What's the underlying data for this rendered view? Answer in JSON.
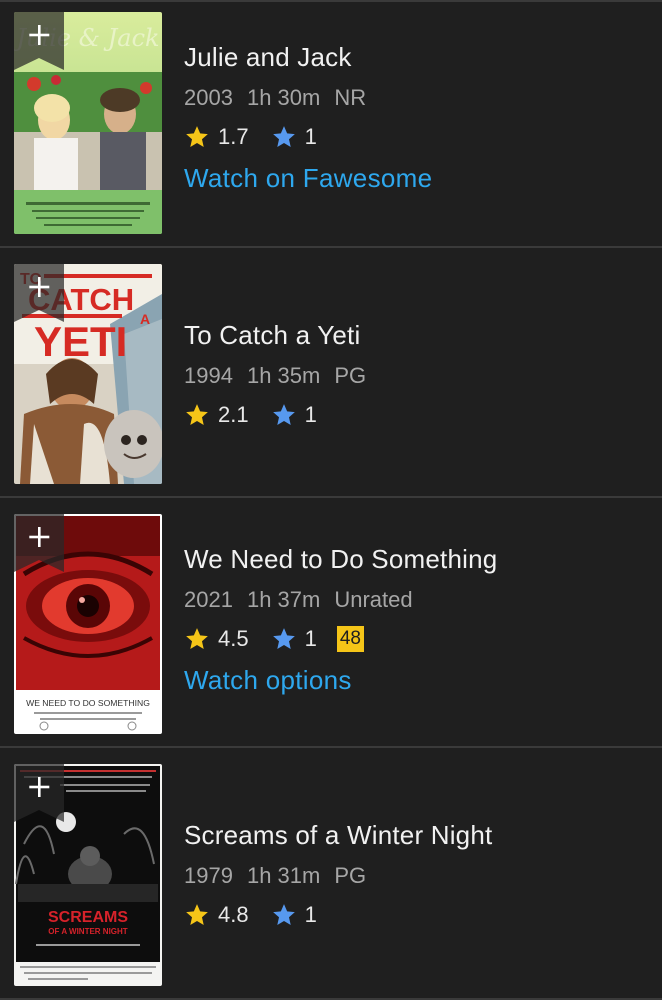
{
  "colors": {
    "imdb_star": "#f5c518",
    "user_star": "#5799ef",
    "link": "#2ea8ee",
    "metascore_bg": "#f5c518"
  },
  "items": [
    {
      "title": "Julie and Jack",
      "year": "2003",
      "runtime": "1h 30m",
      "certificate": "NR",
      "rating": "1.7",
      "user_rating": "1",
      "link": "Watch on Fawesome",
      "poster_text": "Julie & Jack",
      "add_icon": "plus-icon"
    },
    {
      "title": "To Catch a Yeti",
      "year": "1994",
      "runtime": "1h 35m",
      "certificate": "PG",
      "rating": "2.1",
      "user_rating": "1",
      "poster_text_top": "TO",
      "poster_text_mid": "CATCH",
      "poster_text_a": "A",
      "poster_text_bottom": "YETI",
      "add_icon": "plus-icon"
    },
    {
      "title": "We Need to Do Something",
      "year": "2021",
      "runtime": "1h 37m",
      "certificate": "Unrated",
      "rating": "4.5",
      "user_rating": "1",
      "metascore": "48",
      "link": "Watch options",
      "poster_text": "WE NEED TO DO SOMETHING",
      "add_icon": "plus-icon"
    },
    {
      "title": "Screams of a Winter Night",
      "year": "1979",
      "runtime": "1h 31m",
      "certificate": "PG",
      "rating": "4.8",
      "user_rating": "1",
      "poster_text": "SCREAMS",
      "poster_text_2": "OF A WINTER NIGHT",
      "add_icon": "plus-icon"
    }
  ]
}
